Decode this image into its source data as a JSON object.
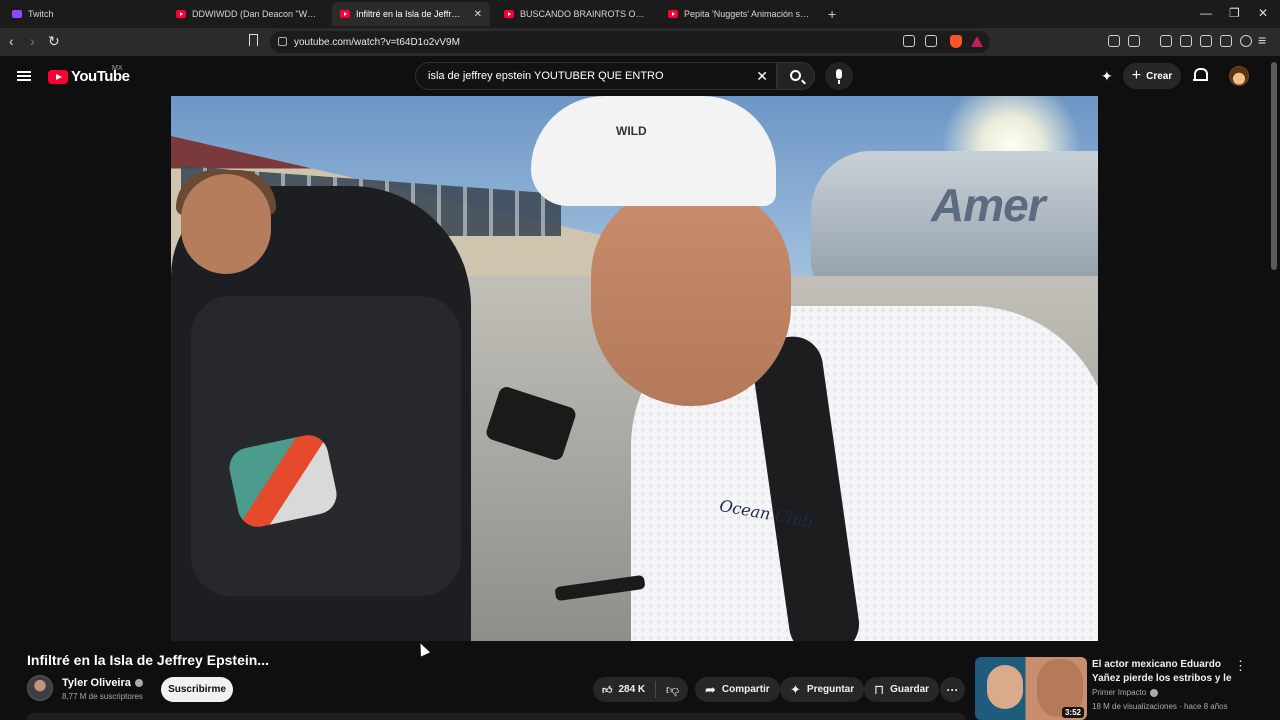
{
  "browser": {
    "tabs": [
      {
        "label": "Twitch",
        "favicon": "twitch-icon"
      },
      {
        "label": "DDWIWDD (Dan Deacon \"When I Was",
        "favicon": "youtube-icon"
      },
      {
        "label": "Infiltré en la Isla de Jeffrey Epste",
        "favicon": "youtube-icon",
        "active": true
      },
      {
        "label": "BUSCANDO BRAINROTS OP Y REGAL",
        "favicon": "youtube-icon"
      },
      {
        "label": "Pepita 'Nuggets' Animación sobre lo",
        "favicon": "youtube-icon"
      }
    ],
    "new_tab": "+",
    "url": "youtube.com/watch?v=t64D1o2vV9M"
  },
  "header": {
    "logo": "YouTube",
    "country": "MX",
    "search_value": "isla de jeffrey epstein YOUTUBER QUE ENTRO",
    "create_label": "Crear"
  },
  "video": {
    "title": "Infiltré en la Isla de Jeffrey Epstein...",
    "shirt_text": "Ocean Club",
    "plane_text": "Amer",
    "cap_text": "WILD"
  },
  "channel": {
    "name": "Tyler Oliveira",
    "subscribers": "8,77 M de suscriptores",
    "subscribe_label": "Suscribirme"
  },
  "actions": {
    "likes": "284 K",
    "share": "Compartir",
    "ask": "Preguntar",
    "save": "Guardar"
  },
  "recommendation": {
    "title": "El actor mexicano Eduardo Yañez pierde los estribos y le ...",
    "channel": "Primer Impacto",
    "meta": "18 M de visualizaciones · hace 8 años",
    "duration": "3:52"
  }
}
